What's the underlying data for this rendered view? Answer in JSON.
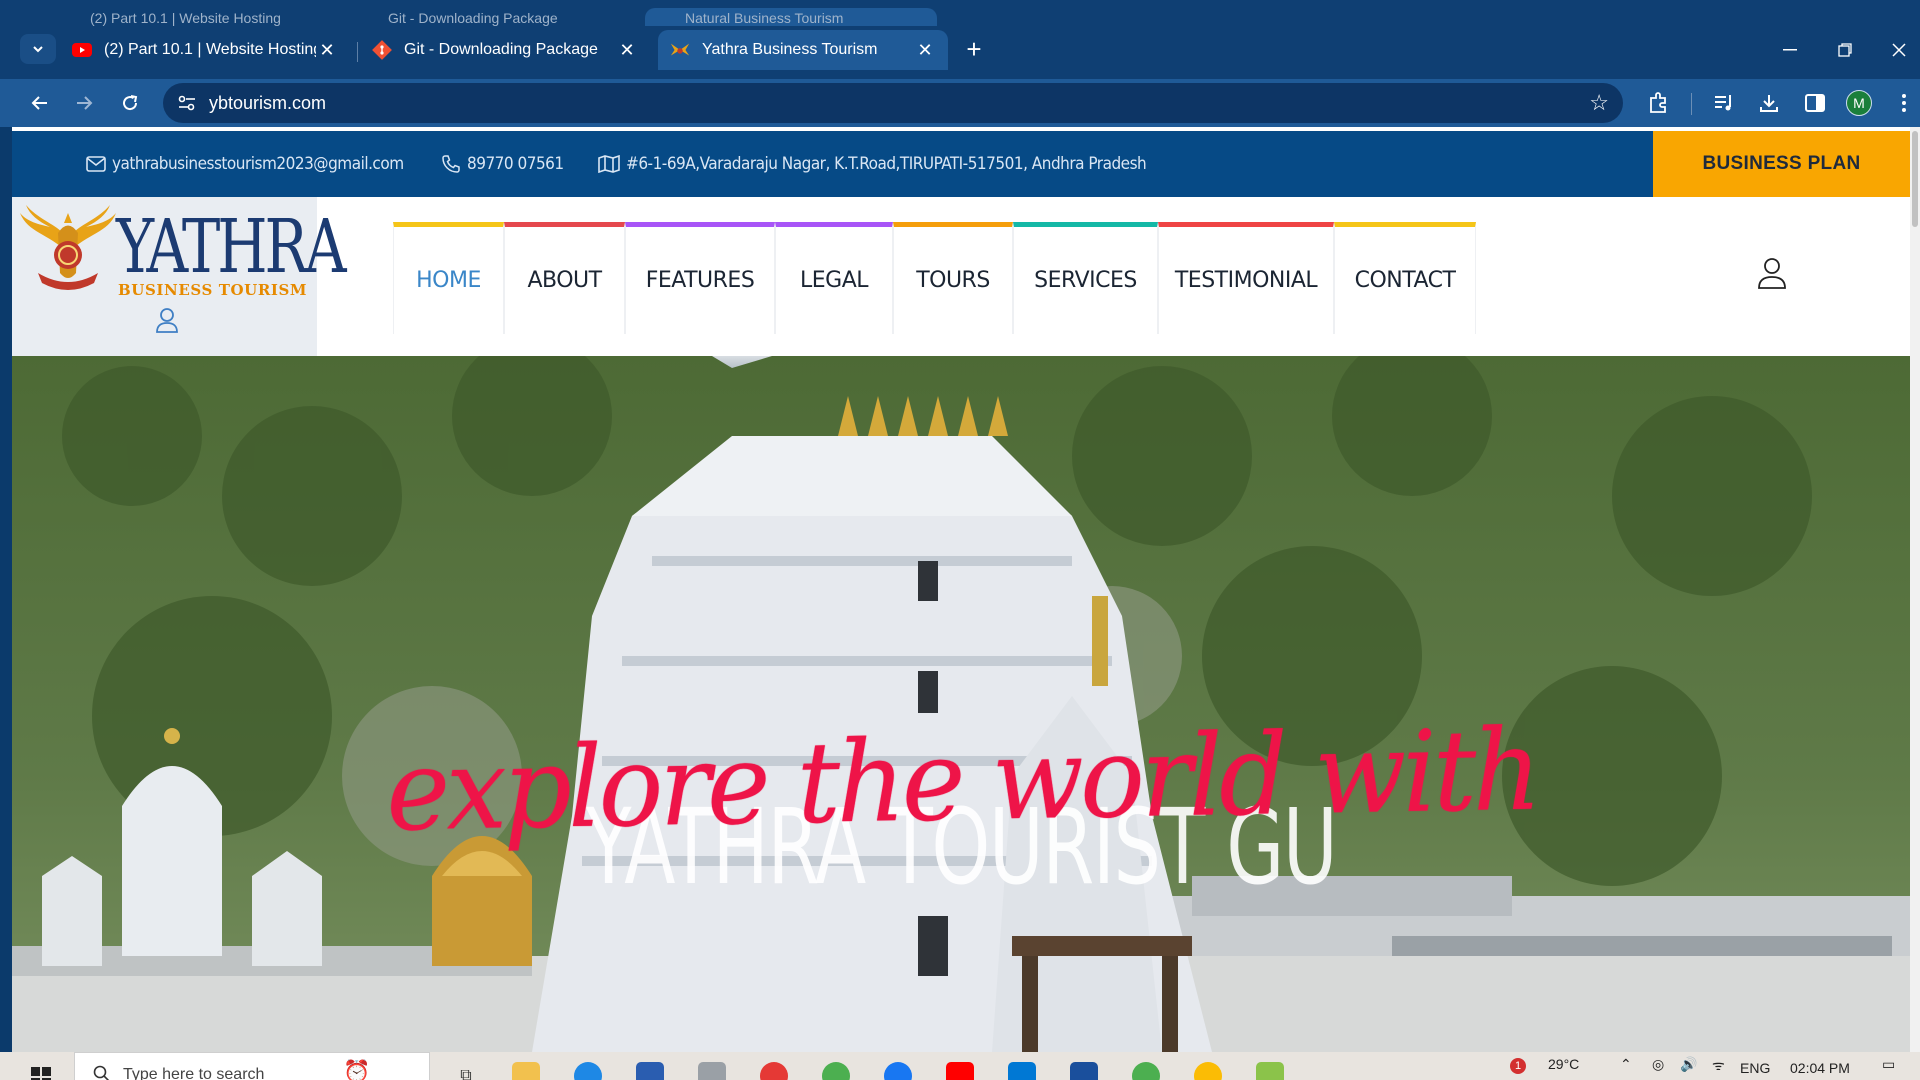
{
  "browser": {
    "ghost_tabs": [
      "(2) Part 10.1 | Website Hosting",
      "Git - Downloading Package",
      "Natural Business Tourism"
    ],
    "tabs": [
      {
        "title": "(2) Part 10.1 | Website Hosting |",
        "icon": "youtube-icon",
        "active": false
      },
      {
        "title": "Git - Downloading Package",
        "icon": "git-icon",
        "active": false
      },
      {
        "title": "Yathra Business Tourism",
        "icon": "yathra-eagle-icon",
        "active": true
      }
    ],
    "new_tab": "+",
    "url": "ybtourism.com",
    "profile_initial": "M"
  },
  "topbar": {
    "email": "yathrabusinesstourism2023@gmail.com",
    "phone": "89770 07561",
    "address": "#6-1-69A,Varadaraju Nagar, K.T.Road,TIRUPATI-517501, Andhra Pradesh",
    "business_plan": "BUSINESS PLAN"
  },
  "logo": {
    "title": "YATHRA",
    "subtitle": "BUSINESS TOURISM"
  },
  "menu": [
    {
      "label": "HOME",
      "active": true,
      "color": "#f5c518"
    },
    {
      "label": "ABOUT",
      "active": false,
      "color": "#e5484d"
    },
    {
      "label": "FEATURES",
      "active": false,
      "color": "#a855f7"
    },
    {
      "label": "LEGAL",
      "active": false,
      "color": "#a855f7"
    },
    {
      "label": "TOURS",
      "active": false,
      "color": "#f59e0b"
    },
    {
      "label": "SERVICES",
      "active": false,
      "color": "#14b8a6"
    },
    {
      "label": "TESTIMONIAL",
      "active": false,
      "color": "#ef4444"
    },
    {
      "label": "CONTACT",
      "active": false,
      "color": "#f5c518"
    }
  ],
  "hero": {
    "script_text": "explore the world with",
    "headline": "YATHRA TOURIST GU"
  },
  "taskbar": {
    "search_placeholder": "Type here to search",
    "weather": "29°C",
    "lang": "ENG",
    "time": "02:04 PM",
    "weather_badge": "1"
  },
  "colors": {
    "chrome_dark": "#0f3f73",
    "chrome_toolbar": "#1f5a97",
    "topbar": "#064a86",
    "accent_orange": "#f9a601",
    "hero_script": "#ee1448"
  }
}
